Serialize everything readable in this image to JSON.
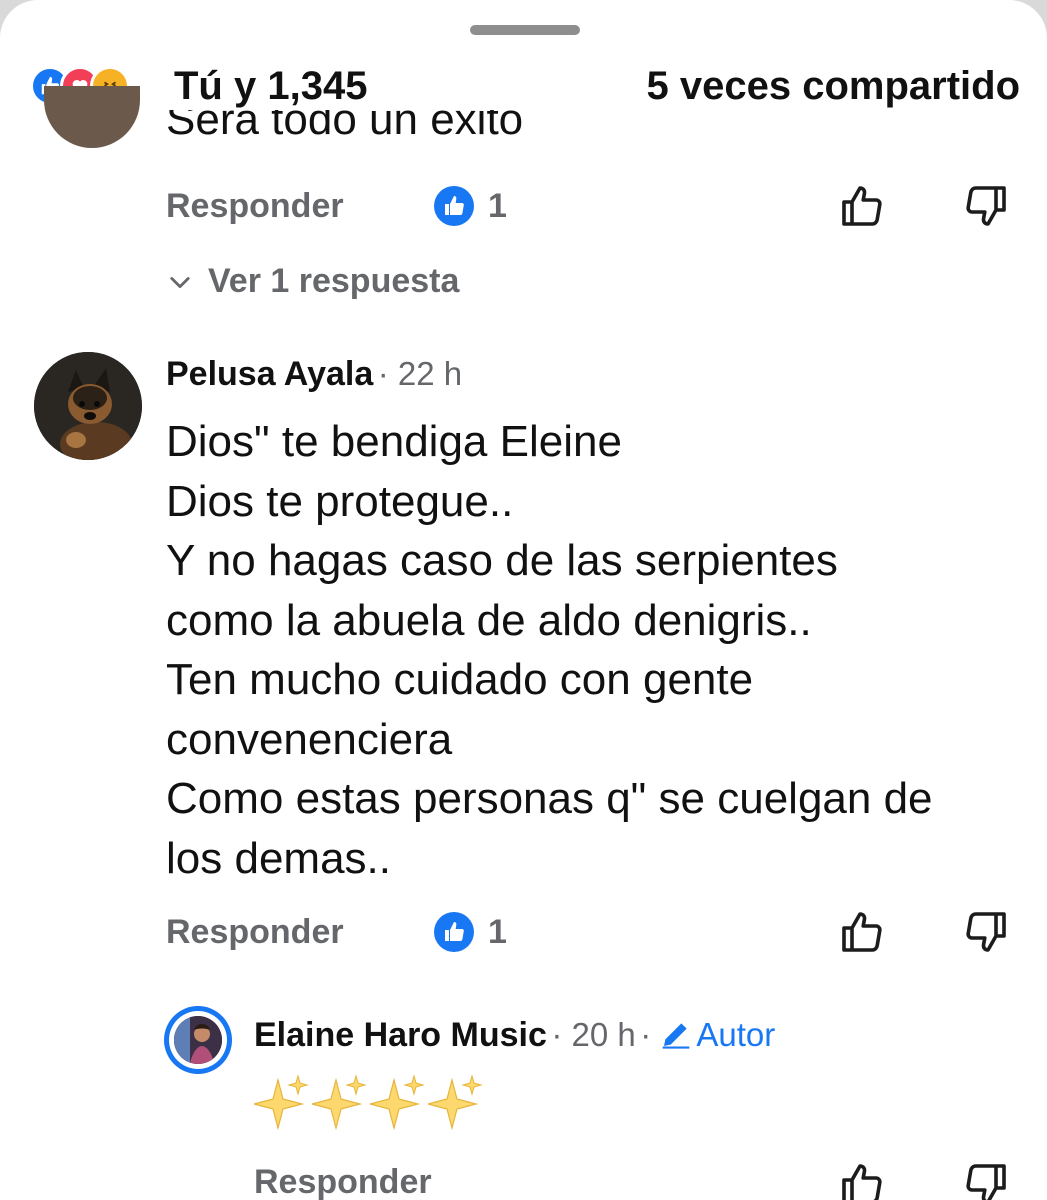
{
  "header": {
    "reactions": [
      "like-icon",
      "love-icon",
      "haha-icon"
    ],
    "count_text": "Tú y 1,345",
    "shares_text": "5 veces compartido"
  },
  "previous_comment": {
    "text_clipped": "Será todo un éxito",
    "reply_label": "Responder",
    "like_count": "1",
    "view_replies": "Ver 1 respuesta"
  },
  "comment": {
    "author": "Pelusa Ayala",
    "time": "22 h",
    "lines": [
      "Dios\" te bendiga Eleine",
      "Dios te protegue..",
      "Y no hagas caso de las serpientes",
      "como la abuela de aldo denigris..",
      "Ten mucho cuidado con gente",
      "convenenciera",
      "Como estas personas q\" se cuelgan de",
      "los demas.."
    ],
    "reply_label": "Responder",
    "like_count": "1"
  },
  "reply": {
    "author": "Elaine Haro Music",
    "time": "20 h",
    "badge": "Autor",
    "body_icons": [
      "sparkles-icon",
      "sparkles-icon",
      "sparkles-icon",
      "sparkles-icon"
    ],
    "reply_label": "Responder"
  },
  "colors": {
    "accent": "#1877f2",
    "secondary_text": "#65676b",
    "love": "#f33e58",
    "haha": "#f7b125"
  }
}
